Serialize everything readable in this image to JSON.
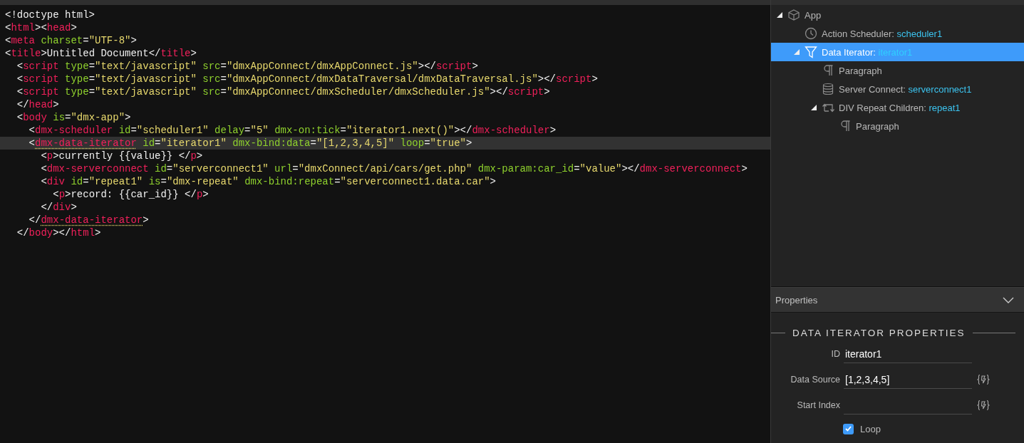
{
  "code": {
    "lines": [
      {
        "highlighted": false,
        "segments": [
          {
            "kind": "plain",
            "text": "<!doctype html>"
          }
        ]
      },
      {
        "highlighted": false,
        "segments": [
          {
            "kind": "plain",
            "text": "<"
          },
          {
            "kind": "tag",
            "text": "html"
          },
          {
            "kind": "plain",
            "text": "><"
          },
          {
            "kind": "tag",
            "text": "head"
          },
          {
            "kind": "plain",
            "text": ">"
          }
        ]
      },
      {
        "highlighted": false,
        "segments": [
          {
            "kind": "plain",
            "text": "<"
          },
          {
            "kind": "tag",
            "text": "meta"
          },
          {
            "kind": "attr",
            "text": " charset"
          },
          {
            "kind": "plain",
            "text": "="
          },
          {
            "kind": "string",
            "text": "\"UTF-8\""
          },
          {
            "kind": "plain",
            "text": ">"
          }
        ]
      },
      {
        "highlighted": false,
        "segments": [
          {
            "kind": "plain",
            "text": "<"
          },
          {
            "kind": "tag",
            "text": "title"
          },
          {
            "kind": "plain",
            "text": ">Untitled Document</"
          },
          {
            "kind": "tag",
            "text": "title"
          },
          {
            "kind": "plain",
            "text": ">"
          }
        ]
      },
      {
        "highlighted": false,
        "segments": [
          {
            "kind": "plain",
            "text": "  <"
          },
          {
            "kind": "tag",
            "text": "script"
          },
          {
            "kind": "attr",
            "text": " type"
          },
          {
            "kind": "plain",
            "text": "="
          },
          {
            "kind": "string",
            "text": "\"text/javascript\""
          },
          {
            "kind": "attr",
            "text": " src"
          },
          {
            "kind": "plain",
            "text": "="
          },
          {
            "kind": "string",
            "text": "\"dmxAppConnect/dmxAppConnect.js\""
          },
          {
            "kind": "plain",
            "text": "></"
          },
          {
            "kind": "tag",
            "text": "script"
          },
          {
            "kind": "plain",
            "text": ">"
          }
        ]
      },
      {
        "highlighted": false,
        "segments": [
          {
            "kind": "plain",
            "text": "  <"
          },
          {
            "kind": "tag",
            "text": "script"
          },
          {
            "kind": "attr",
            "text": " type"
          },
          {
            "kind": "plain",
            "text": "="
          },
          {
            "kind": "string",
            "text": "\"text/javascript\""
          },
          {
            "kind": "attr",
            "text": " src"
          },
          {
            "kind": "plain",
            "text": "="
          },
          {
            "kind": "string",
            "text": "\"dmxAppConnect/dmxDataTraversal/dmxDataTraversal.js\""
          },
          {
            "kind": "plain",
            "text": "></"
          },
          {
            "kind": "tag",
            "text": "script"
          },
          {
            "kind": "plain",
            "text": ">"
          }
        ]
      },
      {
        "highlighted": false,
        "segments": [
          {
            "kind": "plain",
            "text": "  <"
          },
          {
            "kind": "tag",
            "text": "script"
          },
          {
            "kind": "attr",
            "text": " type"
          },
          {
            "kind": "plain",
            "text": "="
          },
          {
            "kind": "string",
            "text": "\"text/javascript\""
          },
          {
            "kind": "attr",
            "text": " src"
          },
          {
            "kind": "plain",
            "text": "="
          },
          {
            "kind": "string",
            "text": "\"dmxAppConnect/dmxScheduler/dmxScheduler.js\""
          },
          {
            "kind": "plain",
            "text": "></"
          },
          {
            "kind": "tag",
            "text": "script"
          },
          {
            "kind": "plain",
            "text": ">"
          }
        ]
      },
      {
        "highlighted": false,
        "segments": [
          {
            "kind": "plain",
            "text": "  </"
          },
          {
            "kind": "tag",
            "text": "head"
          },
          {
            "kind": "plain",
            "text": ">"
          }
        ]
      },
      {
        "highlighted": false,
        "segments": [
          {
            "kind": "plain",
            "text": "  <"
          },
          {
            "kind": "tag",
            "text": "body"
          },
          {
            "kind": "attr",
            "text": " is"
          },
          {
            "kind": "plain",
            "text": "="
          },
          {
            "kind": "string",
            "text": "\"dmx-app\""
          },
          {
            "kind": "plain",
            "text": ">"
          }
        ]
      },
      {
        "highlighted": false,
        "segments": [
          {
            "kind": "plain",
            "text": "    <"
          },
          {
            "kind": "tag",
            "text": "dmx-scheduler"
          },
          {
            "kind": "attr",
            "text": " id"
          },
          {
            "kind": "plain",
            "text": "="
          },
          {
            "kind": "string",
            "text": "\"scheduler1\""
          },
          {
            "kind": "attr",
            "text": " delay"
          },
          {
            "kind": "plain",
            "text": "="
          },
          {
            "kind": "string",
            "text": "\"5\""
          },
          {
            "kind": "attr",
            "text": " dmx-on:tick"
          },
          {
            "kind": "plain",
            "text": "="
          },
          {
            "kind": "string",
            "text": "\"iterator1.next()\""
          },
          {
            "kind": "plain",
            "text": "></"
          },
          {
            "kind": "tag",
            "text": "dmx-scheduler"
          },
          {
            "kind": "plain",
            "text": ">"
          }
        ]
      },
      {
        "highlighted": true,
        "segments": [
          {
            "kind": "plain",
            "text": "    <"
          },
          {
            "kind": "tag",
            "text": "dmx-data-iterator",
            "matched": true
          },
          {
            "kind": "attr",
            "text": " id"
          },
          {
            "kind": "plain",
            "text": "="
          },
          {
            "kind": "string",
            "text": "\"iterator1\""
          },
          {
            "kind": "attr",
            "text": " dmx-bind:data"
          },
          {
            "kind": "plain",
            "text": "="
          },
          {
            "kind": "string",
            "text": "\"[1,2,3,4,5]\""
          },
          {
            "kind": "attr",
            "text": " loop"
          },
          {
            "kind": "plain",
            "text": "="
          },
          {
            "kind": "string",
            "text": "\"true\""
          },
          {
            "kind": "plain",
            "text": ">"
          }
        ]
      },
      {
        "highlighted": false,
        "segments": [
          {
            "kind": "plain",
            "text": "      <"
          },
          {
            "kind": "tag",
            "text": "p"
          },
          {
            "kind": "plain",
            "text": ">currently {{value}} </"
          },
          {
            "kind": "tag",
            "text": "p"
          },
          {
            "kind": "plain",
            "text": ">"
          }
        ]
      },
      {
        "highlighted": false,
        "segments": [
          {
            "kind": "plain",
            "text": "      <"
          },
          {
            "kind": "tag",
            "text": "dmx-serverconnect"
          },
          {
            "kind": "attr",
            "text": " id"
          },
          {
            "kind": "plain",
            "text": "="
          },
          {
            "kind": "string",
            "text": "\"serverconnect1\""
          },
          {
            "kind": "attr",
            "text": " url"
          },
          {
            "kind": "plain",
            "text": "="
          },
          {
            "kind": "string",
            "text": "\"dmxConnect/api/cars/get.php\""
          },
          {
            "kind": "attr",
            "text": " dmx-param:car_id"
          },
          {
            "kind": "plain",
            "text": "="
          },
          {
            "kind": "string",
            "text": "\"value\""
          },
          {
            "kind": "plain",
            "text": "></"
          },
          {
            "kind": "tag",
            "text": "dmx-serverconnect"
          },
          {
            "kind": "plain",
            "text": ">"
          }
        ]
      },
      {
        "highlighted": false,
        "segments": [
          {
            "kind": "plain",
            "text": "      <"
          },
          {
            "kind": "tag",
            "text": "div"
          },
          {
            "kind": "attr",
            "text": " id"
          },
          {
            "kind": "plain",
            "text": "="
          },
          {
            "kind": "string",
            "text": "\"repeat1\""
          },
          {
            "kind": "attr",
            "text": " is"
          },
          {
            "kind": "plain",
            "text": "="
          },
          {
            "kind": "string",
            "text": "\"dmx-repeat\""
          },
          {
            "kind": "attr",
            "text": " dmx-bind:repeat"
          },
          {
            "kind": "plain",
            "text": "="
          },
          {
            "kind": "string",
            "text": "\"serverconnect1.data.car\""
          },
          {
            "kind": "plain",
            "text": ">"
          }
        ]
      },
      {
        "highlighted": false,
        "segments": [
          {
            "kind": "plain",
            "text": "        <"
          },
          {
            "kind": "tag",
            "text": "p"
          },
          {
            "kind": "plain",
            "text": ">record: {{car_id}} </"
          },
          {
            "kind": "tag",
            "text": "p"
          },
          {
            "kind": "plain",
            "text": ">"
          }
        ]
      },
      {
        "highlighted": false,
        "segments": [
          {
            "kind": "plain",
            "text": "      </"
          },
          {
            "kind": "tag",
            "text": "div"
          },
          {
            "kind": "plain",
            "text": ">"
          }
        ]
      },
      {
        "highlighted": false,
        "segments": [
          {
            "kind": "plain",
            "text": "    </"
          },
          {
            "kind": "tag",
            "text": "dmx-data-iterator",
            "matched": true
          },
          {
            "kind": "plain",
            "text": ">"
          }
        ]
      },
      {
        "highlighted": false,
        "segments": [
          {
            "kind": "plain",
            "text": "  </"
          },
          {
            "kind": "tag",
            "text": "body"
          },
          {
            "kind": "plain",
            "text": "></"
          },
          {
            "kind": "tag",
            "text": "html"
          },
          {
            "kind": "plain",
            "text": ">"
          }
        ]
      }
    ]
  },
  "outline": {
    "items": [
      {
        "kind": "app",
        "label": "App",
        "selected": false,
        "expanded": true,
        "children": [
          {
            "kind": "scheduler",
            "label": "Action Scheduler:",
            "id_text": "scheduler1",
            "selected": false
          },
          {
            "kind": "iterator",
            "label": "Data Iterator:",
            "id_text": "iterator1",
            "selected": true,
            "expanded": true,
            "children": [
              {
                "kind": "paragraph",
                "label": "Paragraph",
                "selected": false
              },
              {
                "kind": "serverconnect",
                "label": "Server Connect:",
                "id_text": "serverconnect1",
                "selected": false
              },
              {
                "kind": "repeat",
                "label": "DIV Repeat Children:",
                "id_text": "repeat1",
                "selected": false,
                "expanded": true,
                "children": [
                  {
                    "kind": "paragraph",
                    "label": "Paragraph",
                    "selected": false
                  }
                ]
              }
            ]
          }
        ]
      }
    ]
  },
  "properties_header": {
    "title": "Properties",
    "expanded": true
  },
  "properties": {
    "section_title": "DATA ITERATOR PROPERTIES",
    "fields": [
      {
        "kind": "text",
        "label": "ID",
        "value": "iterator1"
      },
      {
        "kind": "bindable",
        "label": "Data Source",
        "value": "[1,2,3,4,5]"
      },
      {
        "kind": "bindable",
        "label": "Start Index"
      }
    ],
    "checkboxes": [
      {
        "label": "Loop",
        "checked": true
      }
    ]
  }
}
